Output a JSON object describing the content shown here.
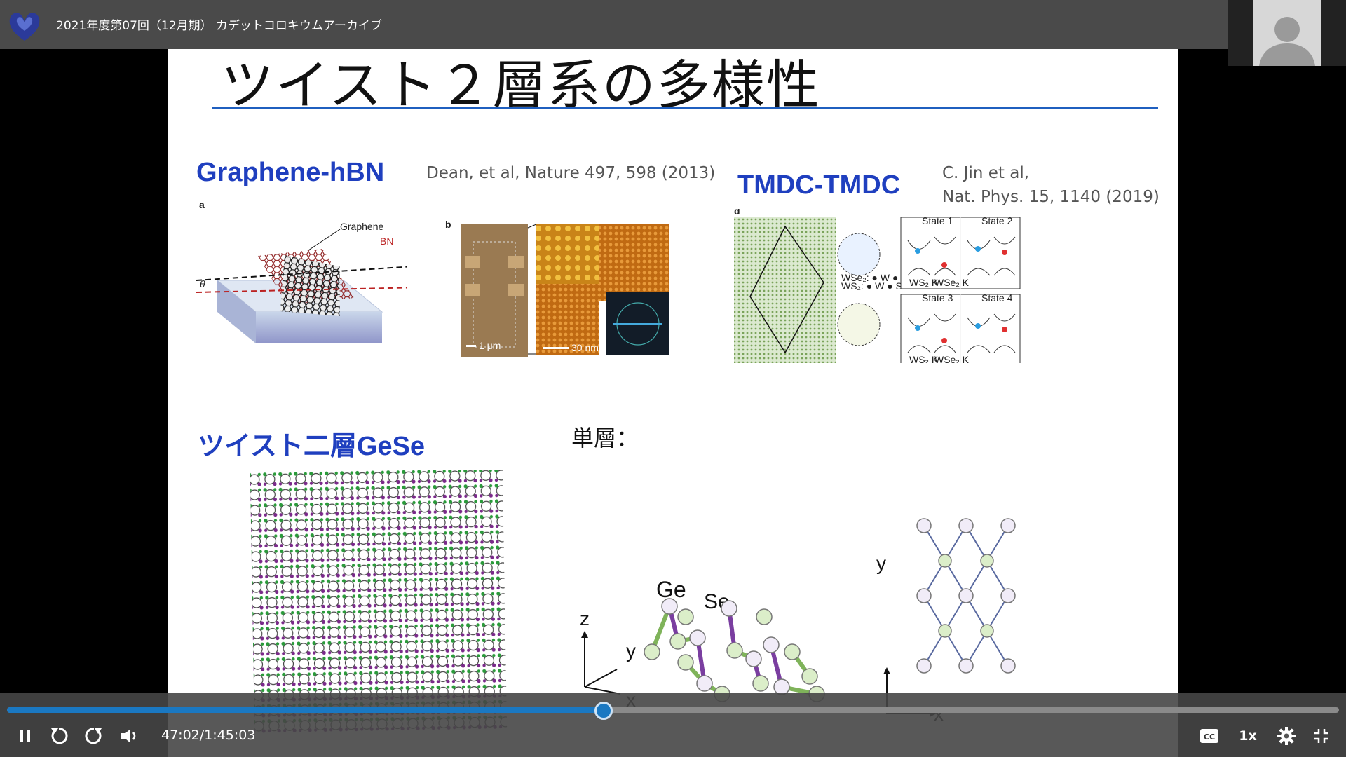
{
  "window": {
    "title": "2021年度第07回（12月期） カデットコロキウムアーカイブ"
  },
  "slide": {
    "title": "ツイスト２層系の多様性",
    "sections": {
      "graphene": {
        "label": "Graphene-hBN",
        "citation": "Dean, et al, Nature 497, 598 (2013)",
        "fig_a": "a",
        "fig_b": "b",
        "graphene_lbl": "Graphene",
        "bn_lbl": "BN",
        "theta": "θ",
        "scale1": "1 μm",
        "scale2": "30 nm"
      },
      "tmdc": {
        "label": "TMDC-TMDC",
        "citation_1": "C. Jin et al,",
        "citation_2": "Nat. Phys. 15, 1140 (2019)",
        "fig_d": "d",
        "states": [
          "State 1",
          "State 2",
          "State 3",
          "State 4"
        ],
        "ws2k": "WS₂ K",
        "wse2k": "WSe₂ K",
        "legend_1": "WSe₂: ● W ● Se",
        "legend_2": "WS₂: ● W ● S"
      },
      "gese": {
        "label": "ツイスト二層GeSe"
      },
      "monolayer": {
        "label": "単層：",
        "ge": "Ge",
        "se": "Se",
        "axis_z": "z",
        "axis_y": "y",
        "axis_x": "x",
        "axis_y2": "y",
        "axis_x2": "x"
      }
    }
  },
  "player": {
    "time": "47:02/1:45:03",
    "progress_fraction": 0.448,
    "speed": "1x",
    "cc_label": "CC",
    "accent": "#1a78c2"
  },
  "icons": {
    "logo": "university-logo-icon",
    "pause": "pause-icon",
    "rewind": "rewind-icon",
    "forward": "forward-icon",
    "volume": "volume-icon",
    "cc": "closed-captions-icon",
    "settings": "gear-icon",
    "exit_fullscreen": "exit-fullscreen-icon"
  }
}
